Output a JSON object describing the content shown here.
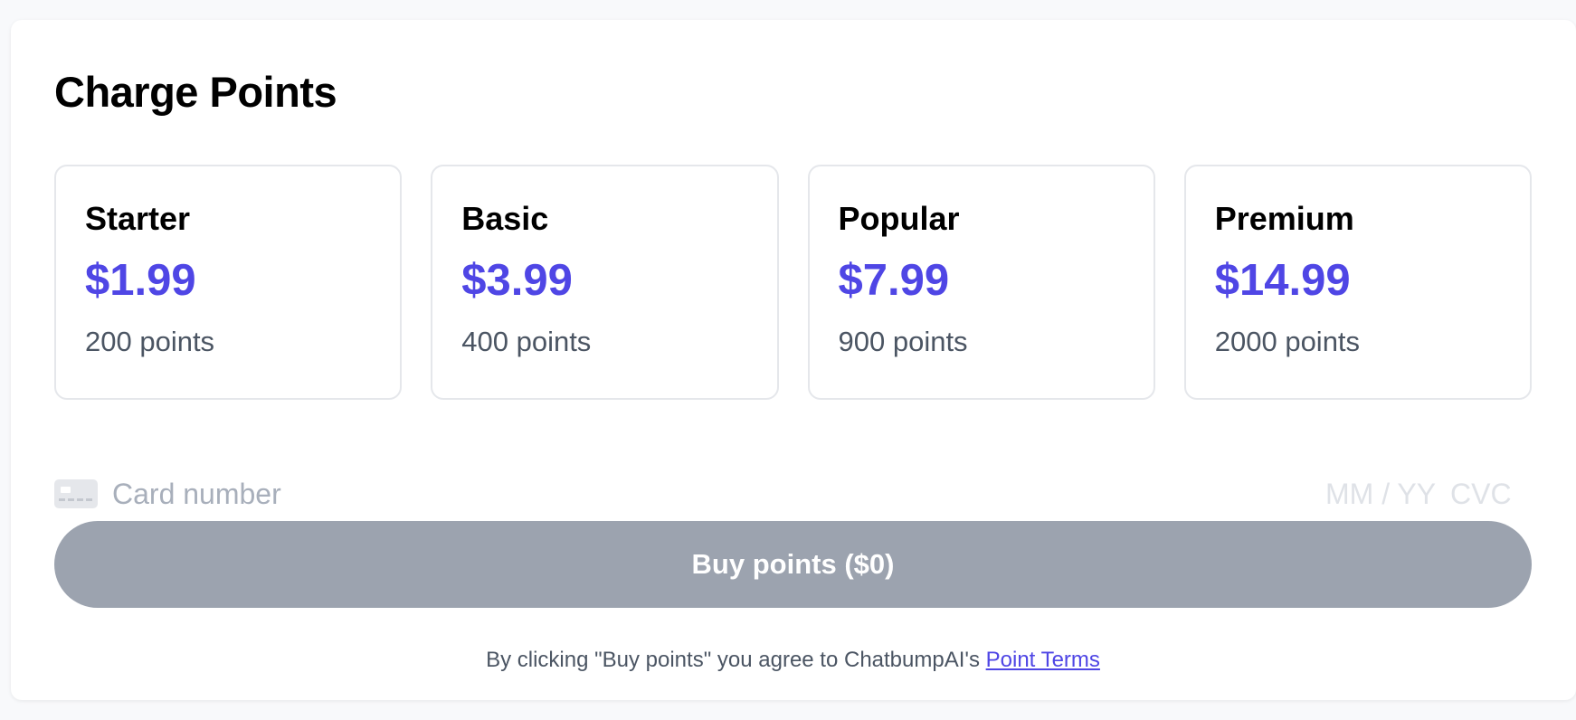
{
  "page": {
    "title": "Charge Points"
  },
  "plans": [
    {
      "name": "Starter",
      "price": "$1.99",
      "points": "200 points"
    },
    {
      "name": "Basic",
      "price": "$3.99",
      "points": "400 points"
    },
    {
      "name": "Popular",
      "price": "$7.99",
      "points": "900 points"
    },
    {
      "name": "Premium",
      "price": "$14.99",
      "points": "2000 points"
    }
  ],
  "payment": {
    "card_icon": "credit-card-icon",
    "card_number_placeholder": "Card number",
    "card_number_value": "",
    "expiry_placeholder": "MM / YY",
    "expiry_value": "",
    "cvc_placeholder": "CVC",
    "cvc_value": ""
  },
  "buy_button": {
    "label": "Buy points ($0)",
    "enabled": false
  },
  "terms": {
    "prefix": "By clicking \"Buy points\" you agree to ChatbumpAI's ",
    "link_label": "Point Terms"
  },
  "colors": {
    "accent": "#4f46e5",
    "button_disabled": "#9ca3af",
    "border": "#e5e7eb",
    "muted_text": "#4b5563"
  }
}
